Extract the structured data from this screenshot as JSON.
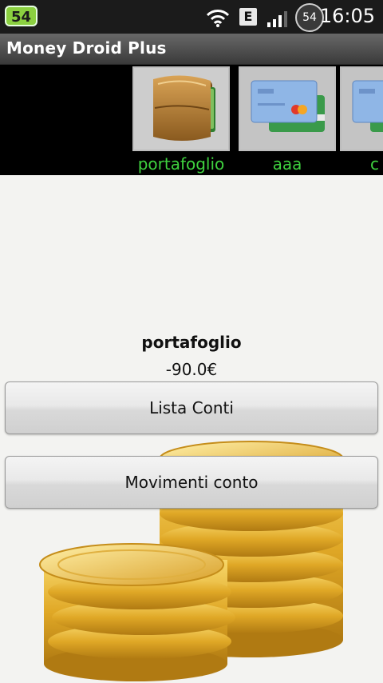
{
  "status_bar": {
    "notification_count": "54",
    "network_type": "E",
    "battery_level": "54",
    "time": "16:05"
  },
  "app": {
    "title": "Money Droid Plus"
  },
  "accounts": [
    {
      "label": "portafoglio",
      "icon": "wallet-icon"
    },
    {
      "label": "aaa",
      "icon": "credit-cards-icon"
    },
    {
      "label": "c",
      "icon": "credit-cards-icon"
    }
  ],
  "selected_account": {
    "name": "portafoglio",
    "balance": "-90.0€"
  },
  "buttons": {
    "list_accounts": "Lista Conti",
    "account_movements": "Movimenti conto"
  },
  "colors": {
    "account_label": "#3fd23f",
    "status_badge": "#8bd040"
  }
}
